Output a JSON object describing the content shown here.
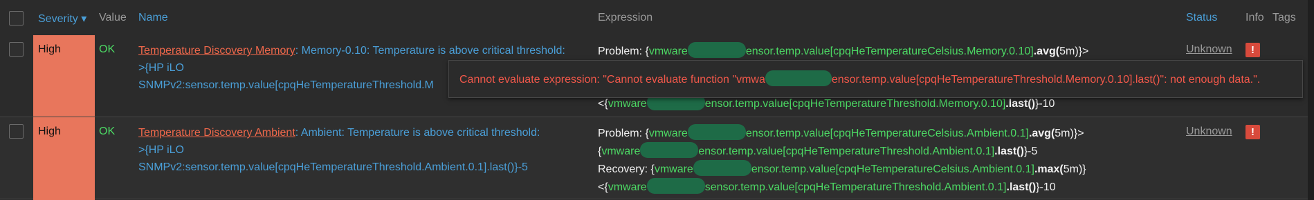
{
  "header": {
    "severity": "Severity ▾",
    "value": "Value",
    "name": "Name",
    "expression": "Expression",
    "status": "Status",
    "info": "Info",
    "tags": "Tags"
  },
  "rows": [
    {
      "severity": "High",
      "value": "OK",
      "trigger_link": "Temperature Discovery Memory",
      "name_rest": ": Memory-0.10: Temperature is above critical threshold:",
      "name_line2": ">{HP iLO",
      "name_line3": "SNMPv2:sensor.temp.value[cpqHeTemperatureThreshold.M",
      "expr": {
        "l1_prefix": "Problem: {",
        "l1_host": "vmware",
        "l1_key": "ensor.temp.value[cpqHeTemperatureCelsius.Memory.0.10]",
        "l1_func": ".avg(",
        "l1_arg": "5m",
        "l1_suffix": ")}>",
        "l4_prefix": "<{",
        "l4_host": "vmware",
        "l4_key": "ensor.temp.value[cpqHeTemperatureThreshold.Memory.0.10]",
        "l4_func": ".last()",
        "l4_suffix": "}-10"
      },
      "status": "Unknown",
      "info_icon": "!"
    },
    {
      "severity": "High",
      "value": "OK",
      "trigger_link": "Temperature Discovery Ambient",
      "name_rest": ": Ambient: Temperature is above critical threshold:",
      "name_line2": ">{HP iLO",
      "name_line3": "SNMPv2:sensor.temp.value[cpqHeTemperatureThreshold.Ambient.0.1].last()}-5",
      "expr": {
        "l1_prefix": "Problem: {",
        "l1_host": "vmware",
        "l1_key": "ensor.temp.value[cpqHeTemperatureCelsius.Ambient.0.1]",
        "l1_func": ".avg(",
        "l1_arg": "5m",
        "l1_suffix": ")}>",
        "l2_prefix": "{",
        "l2_host": "vmware",
        "l2_key": "ensor.temp.value[cpqHeTemperatureThreshold.Ambient.0.1]",
        "l2_func": ".last()",
        "l2_suffix": "}-5",
        "l3_prefix": "Recovery: {",
        "l3_host": "vmware",
        "l3_key": "ensor.temp.value[cpqHeTemperatureCelsius.Ambient.0.1]",
        "l3_func": ".max(",
        "l3_arg": "5m",
        "l3_suffix": ")}",
        "l4_prefix": "<{",
        "l4_host": "vmware",
        "l4_key": "sensor.temp.value[cpqHeTemperatureThreshold.Ambient.0.1]",
        "l4_func": ".last()",
        "l4_suffix": "}-10"
      },
      "status": "Unknown",
      "info_icon": "!"
    }
  ],
  "hint": {
    "text_start": "Cannot evaluate expression: \"Cannot evaluate function \"vmwa",
    "text_end": "ensor.temp.value[cpqHeTemperatureThreshold.Memory.0.10].last()\": not enough data.\"."
  },
  "colors": {
    "severity_high": "#e8765c",
    "ok_green": "#4cd964",
    "link_blue": "#4a9fd8",
    "trigger_red": "#f0684b",
    "error_red": "#f2584a",
    "info_red": "#d84a3c"
  }
}
